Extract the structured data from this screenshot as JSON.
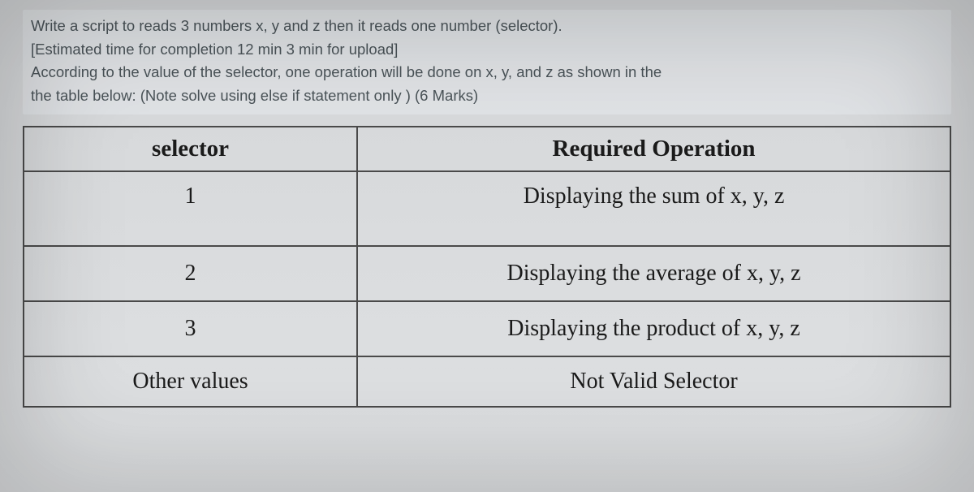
{
  "question": {
    "line1": "Write a script to reads 3 numbers x, y and z then it reads one number (selector).",
    "line2": "[Estimated time for completion 12 min 3 min for upload]",
    "line3": "According to the value of the selector, one operation will be done on x, y, and z as shown in the",
    "line4": "the table below: (Note solve using else if statement only ) (6 Marks)"
  },
  "table": {
    "headers": {
      "selector": "selector",
      "operation": "Required Operation"
    },
    "rows": [
      {
        "selector": "1",
        "operation": "Displaying the sum of x, y, z"
      },
      {
        "selector": "2",
        "operation": "Displaying the average of x, y, z"
      },
      {
        "selector": "3",
        "operation": "Displaying the product of x, y, z"
      },
      {
        "selector": "Other values",
        "operation": "Not Valid Selector"
      }
    ]
  }
}
